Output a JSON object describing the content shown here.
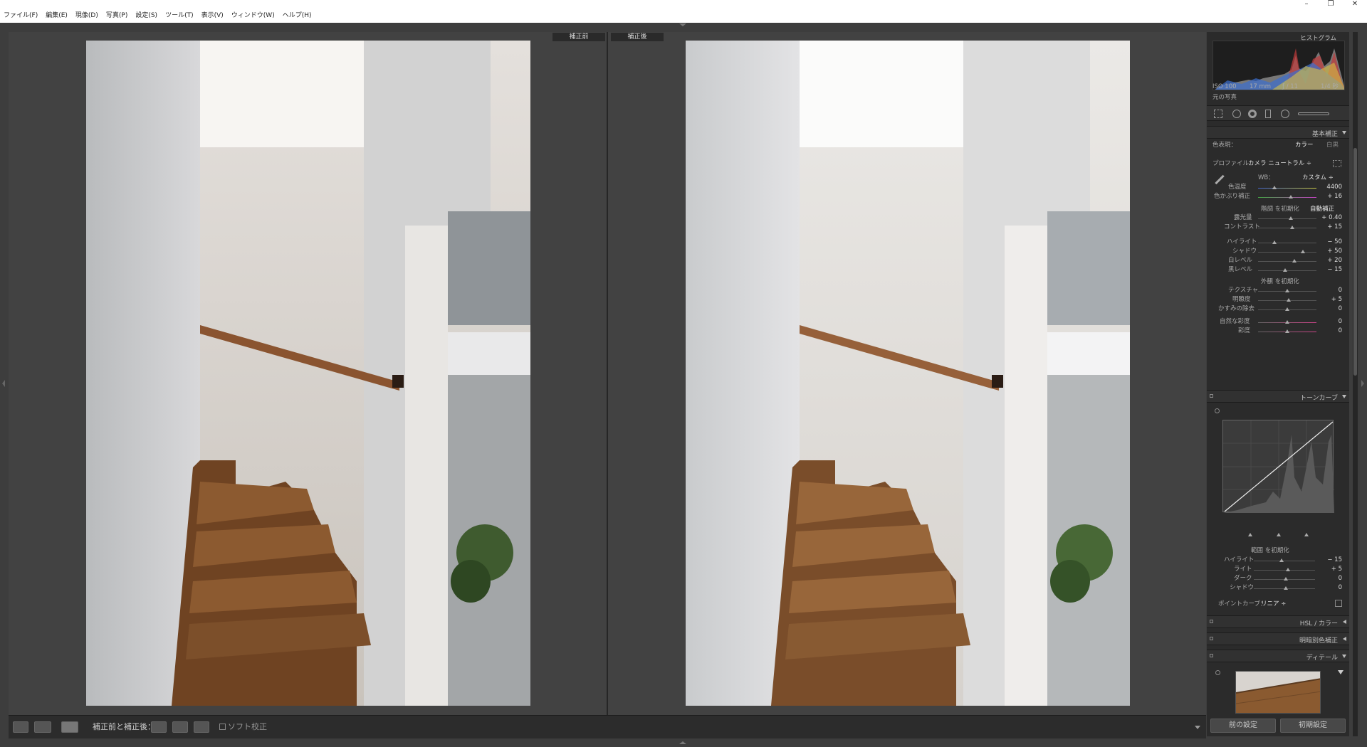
{
  "menubar": {
    "items": [
      "ファイル(F)",
      "編集(E)",
      "現像(D)",
      "写真(P)",
      "設定(S)",
      "ツール(T)",
      "表示(V)",
      "ウィンドウ(W)",
      "ヘルプ(H)"
    ]
  },
  "window_controls": {
    "minimize": "–",
    "maximize": "❐",
    "close": "✕"
  },
  "view": {
    "before_label": "補正前",
    "after_label": "補正後"
  },
  "toolbar": {
    "compare_label": "補正前と補正後：",
    "softproof_label": "ソフト校正"
  },
  "histogram": {
    "title": "ヒストグラム",
    "iso": "ISO 100",
    "focal": "17 mm",
    "aperture": "ƒ / 11",
    "shutter": "1/4 秒",
    "original_label": "元の写真"
  },
  "basic": {
    "title": "基本補正",
    "treatment_label": "色表現：",
    "treatment_color": "カラー",
    "treatment_bw": "白黒",
    "profile_label": "プロファイル：",
    "profile_value": "カメラ ニュートラル ÷",
    "wb_label": "WB：",
    "wb_value": "カスタム ÷",
    "temp_label": "色温度",
    "temp_value": "4400",
    "tint_label": "色かぶり補正",
    "tint_value": "+ 16",
    "tone_label": "階調 を初期化",
    "auto_label": "自動補正",
    "exposure_label": "露光量",
    "exposure_value": "+ 0.40",
    "contrast_label": "コントラスト",
    "contrast_value": "+ 15",
    "highlights_label": "ハイライト",
    "highlights_value": "− 50",
    "shadows_label": "シャドウ",
    "shadows_value": "+ 50",
    "whites_label": "白レベル",
    "whites_value": "+ 20",
    "blacks_label": "黒レベル",
    "blacks_value": "− 15",
    "presence_label": "外観 を初期化",
    "texture_label": "テクスチャ",
    "texture_value": "0",
    "clarity_label": "明瞭度",
    "clarity_value": "+ 5",
    "dehaze_label": "かすみの除去",
    "dehaze_value": "0",
    "vibrance_label": "自然な彩度",
    "vibrance_value": "0",
    "saturation_label": "彩度",
    "saturation_value": "0"
  },
  "tonecurve": {
    "title": "トーンカーブ",
    "region_label": "範囲 を初期化",
    "highlights_label": "ハイライト",
    "highlights_value": "− 15",
    "lights_label": "ライト",
    "lights_value": "+ 5",
    "darks_label": "ダーク",
    "darks_value": "0",
    "shadows_label": "シャドウ",
    "shadows_value": "0",
    "pointcurve_label": "ポイントカーブ：",
    "pointcurve_value": "リニア ÷"
  },
  "hsl": {
    "title": "HSL / カラー"
  },
  "splittone": {
    "title": "明暗別色補正"
  },
  "detail": {
    "title": "ディテール"
  },
  "buttons": {
    "previous": "前の設定",
    "reset": "初期設定"
  },
  "colors": {
    "panel": "#2b2b2b",
    "workarea": "#424242",
    "accent": "#cccccc"
  }
}
